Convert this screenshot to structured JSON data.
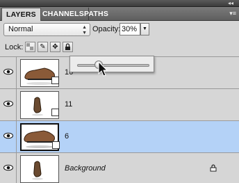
{
  "panel_tabs": [
    "LAYERS",
    "CHANNELS",
    "PATHS"
  ],
  "blend_mode": "Normal",
  "opacity": {
    "label": "Opacity:",
    "value": "30%"
  },
  "opacity_slider_fraction": 0.3,
  "lock_label": "Lock:",
  "layers": [
    {
      "name": "16",
      "selected": false
    },
    {
      "name": "11",
      "selected": false
    },
    {
      "name": "6",
      "selected": true
    },
    {
      "name": "Background",
      "selected": false,
      "locked": true
    }
  ],
  "icons": {
    "panel_menu": "panel-menu-icon",
    "visibility": "eye-icon",
    "lock": "lock-icon",
    "lock_transparent": "checkerboard-icon",
    "lock_image": "brush-icon",
    "lock_position": "move-arrows-icon",
    "lock_all": "padlock-icon"
  },
  "colors": {
    "selected_row": "#b4d2f7",
    "panel_bg": "#d6d6d6"
  }
}
